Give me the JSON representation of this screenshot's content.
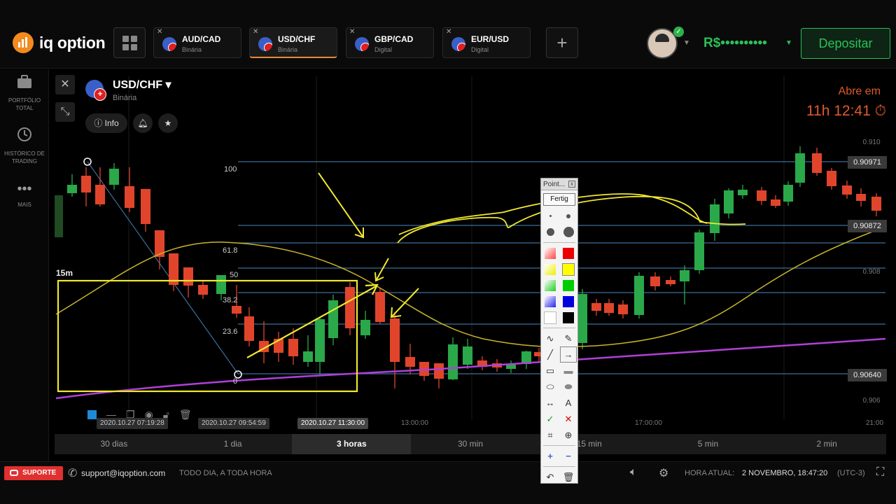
{
  "app": {
    "logo_text": "iq option"
  },
  "tabs": [
    {
      "name": "AUD/CAD",
      "type": "Binária",
      "active": false
    },
    {
      "name": "USD/CHF",
      "type": "Binária",
      "active": true
    },
    {
      "name": "GBP/CAD",
      "type": "Digital",
      "active": false
    },
    {
      "name": "EUR/USD",
      "type": "Digital",
      "active": false
    }
  ],
  "account": {
    "balance": "R$••••••••••",
    "deposit_label": "Depositar"
  },
  "sidebar": {
    "items": [
      {
        "label": "PORTFÓLIO TOTAL",
        "icon": "briefcase-icon"
      },
      {
        "label": "HISTÓRICO DE TRADING",
        "icon": "history-icon"
      },
      {
        "label": "MAIS",
        "icon": "more-icon"
      }
    ]
  },
  "asset": {
    "name": "USD/CHF",
    "type": "Binária",
    "info_label": "Info"
  },
  "market": {
    "opens_label": "Abre em",
    "opens_time": "11h 12:41"
  },
  "chart": {
    "timeframe": "15m",
    "fib_levels": [
      "100",
      "61.8",
      "50",
      "38.2",
      "23.6",
      "0"
    ],
    "price_tags": [
      "0.90971",
      "0.90872",
      "0.90640"
    ],
    "price_axis": [
      "0.910",
      "0.908",
      "0.906"
    ],
    "time_labels": [
      "2020.10.27 07:19:28",
      "2020.10.27 09:54:59",
      "2020.10.27 11:30:00",
      "13:00:00",
      "17:00:00",
      "21:00"
    ],
    "colors": {
      "up": "#2aa84a",
      "down": "#e0452c",
      "ma_fast": "#c8b42a",
      "ma_slow": "#b040d8",
      "annotation": "#f0e830",
      "fib": "#3c6e9a"
    }
  },
  "periods": [
    {
      "label": "30 dias",
      "selected": false
    },
    {
      "label": "1 dia",
      "selected": false
    },
    {
      "label": "3 horas",
      "selected": true
    },
    {
      "label": "30 min",
      "selected": false
    },
    {
      "label": "15 min",
      "selected": false
    },
    {
      "label": "5 min",
      "selected": false
    },
    {
      "label": "2 min",
      "selected": false
    }
  ],
  "palette": {
    "title": "Point...",
    "done_label": "Fertig"
  },
  "footer": {
    "support_label": "SUPORTE",
    "email": "support@iqoption.com",
    "availability": "TODO DIA, A TODA HORA",
    "time_label": "HORA ATUAL:",
    "time_value": "2 NOVEMBRO, 18:47:20",
    "timezone": "(UTC-3)"
  }
}
